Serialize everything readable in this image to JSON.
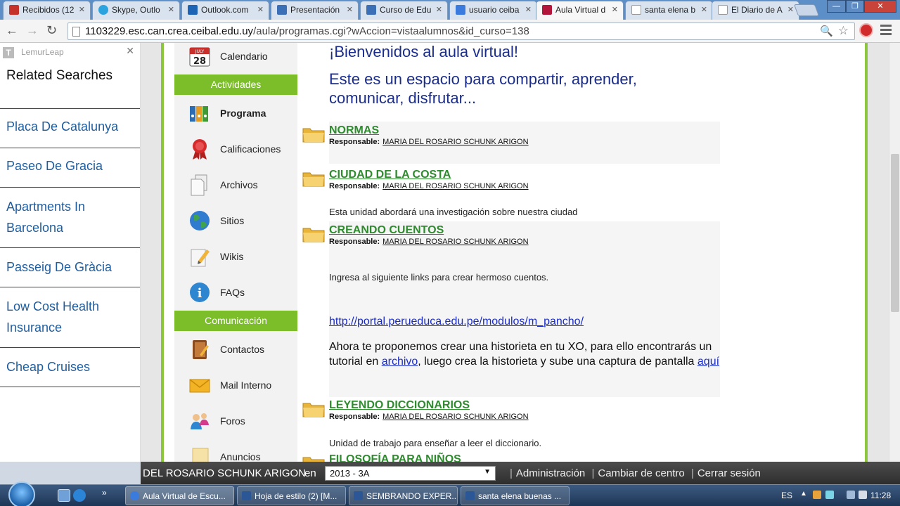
{
  "browser": {
    "tabs": [
      {
        "label": "Recibidos (12",
        "icon": "gmail-icon",
        "color": "#c5322a"
      },
      {
        "label": "Skype, Outlo",
        "icon": "skype-icon",
        "color": "#2aa3df"
      },
      {
        "label": "Outlook.com",
        "icon": "outlook-icon",
        "color": "#1e64b4"
      },
      {
        "label": "Presentación",
        "icon": "slides-icon",
        "color": "#3b6fb6"
      },
      {
        "label": "Curso de Edu",
        "icon": "page-icon",
        "color": "#3b6fb6"
      },
      {
        "label": "usuario ceiba",
        "icon": "google-icon",
        "color": "#3c7bde"
      },
      {
        "label": "Aula Virtual d",
        "icon": "aula-icon",
        "color": "#b3163b"
      },
      {
        "label": "santa elena b",
        "icon": "document-icon",
        "color": "#dddddd"
      },
      {
        "label": "El Diario de A",
        "icon": "document-icon",
        "color": "#dddddd"
      }
    ],
    "url_host": "1103229.esc.can.crea.ceibal.edu.uy",
    "url_path": "/aula/programas.cgi?wAccion=vistaalumnos&id_curso=138"
  },
  "lemurleap": {
    "name": "LemurLeap",
    "title": "Related Searches",
    "items": [
      {
        "label": "Placa De Catalunya"
      },
      {
        "label": "Paseo De Gracia"
      },
      {
        "label": "Apartments In Barcelona"
      },
      {
        "label": "Passeig De Gràcia"
      },
      {
        "label": "Low Cost Health Insurance"
      },
      {
        "label": "Cheap Cruises"
      }
    ]
  },
  "nav": {
    "calendar_day": "28",
    "calendar_month": "JULY",
    "items": {
      "calendario": "Calendario",
      "programa": "Programa",
      "calificaciones": "Calificaciones",
      "archivos": "Archivos",
      "sitios": "Sitios",
      "wikis": "Wikis",
      "faqs": "FAQs",
      "contactos": "Contactos",
      "mail": "Mail Interno",
      "foros": "Foros",
      "anuncios": "Anuncios"
    },
    "sections": {
      "actividades": "Actividades",
      "comunicacion": "Comunicación"
    }
  },
  "main": {
    "welcome": "¡Bienvenidos al aula virtual!",
    "intro": "Este es un espacio para compartir, aprender, comunicar, disfrutar...",
    "responsable_label": "Responsable:",
    "responsable_name": "MARIA DEL ROSARIO SCHUNK ARIGON",
    "units": [
      {
        "title": "NORMAS"
      },
      {
        "title": "CIUDAD DE LA COSTA",
        "desc": "Esta unidad abordará una investigación sobre nuestra ciudad"
      },
      {
        "title": "CREANDO CUENTOS",
        "desc": "Ingresa al siguiente links para crear hermoso cuentos."
      },
      {
        "title": "LEYENDO DICCIONARIOS",
        "desc": "Unidad de trabajo para enseñar a leer el diccionario."
      },
      {
        "title": "FILOSOFÍA PARA NIÑOS"
      }
    ],
    "link": "http://portal.perueduca.edu.pe/modulos/m_pancho/",
    "para": {
      "part1": "Ahora te proponemos crear una historieta en tu XO, para ello encontrarás un tutorial en ",
      "link1": "archivo",
      "part2": ", luego crea la historieta y sube una captura de pantalla ",
      "link2": "aquí"
    }
  },
  "sitebar": {
    "user": "DEL ROSARIO SCHUNK ARIGON",
    "en": "en",
    "course": "2013 - 3A",
    "links": [
      "Administración",
      "Cambiar de centro",
      "Cerrar sesión"
    ]
  },
  "taskbar": {
    "tasks": [
      {
        "label": "Aula Virtual de Escu...",
        "color": "#3c7bde"
      },
      {
        "label": "Hoja de estilo (2) [M...",
        "color": "#2b5797"
      },
      {
        "label": "SEMBRANDO EXPER...",
        "color": "#2b5797"
      },
      {
        "label": "santa elena buenas ...",
        "color": "#2b5797"
      }
    ],
    "lang": "ES",
    "time": "11:28"
  },
  "colors": {
    "accent_green": "#7cbd2a",
    "title_blue": "#1a2d8c",
    "unit_green": "#2e8b2e"
  }
}
